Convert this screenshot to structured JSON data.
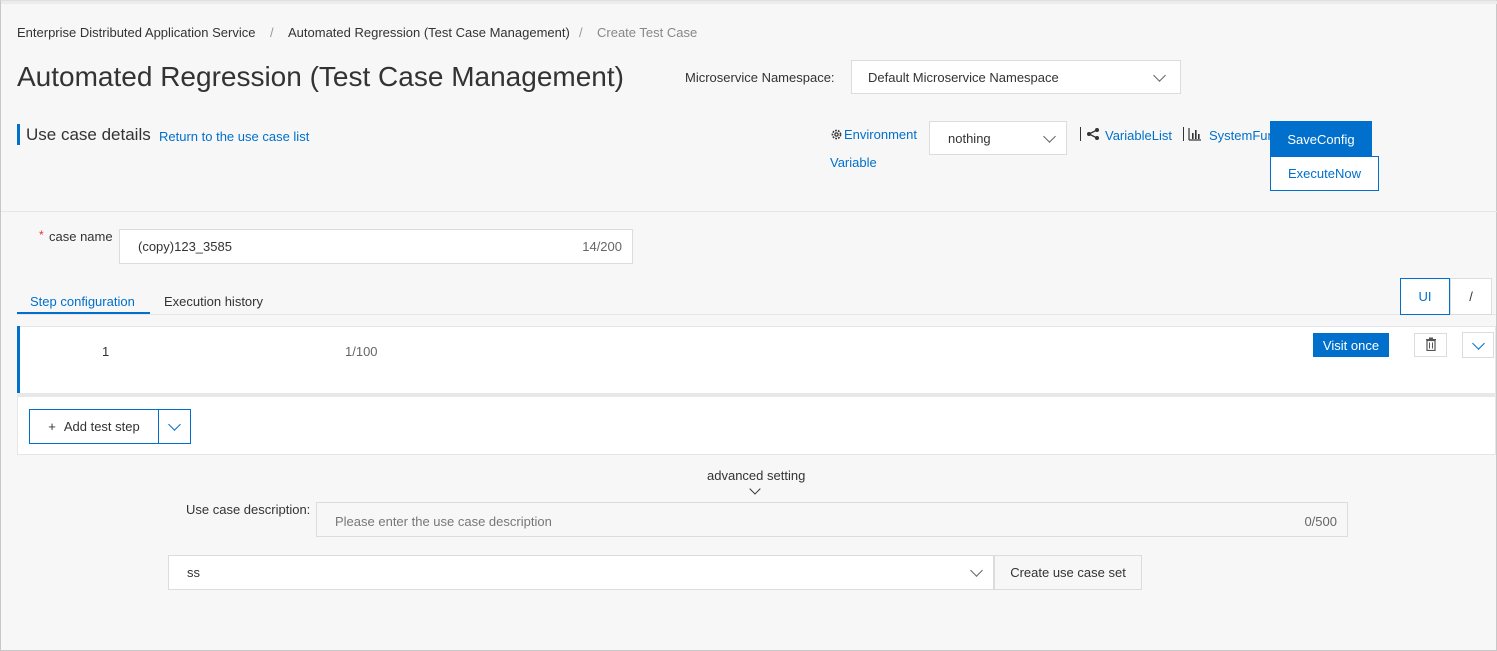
{
  "breadcrumb": [
    "Enterprise Distributed Application Service",
    "Automated Regression (Test Case Management)",
    "Create Test Case"
  ],
  "breadcrumb_separator": "/",
  "page_title": "Automated Regression (Test Case Management)",
  "namespace": {
    "label": "Microservice Namespace:",
    "value": "Default Microservice Namespace"
  },
  "section": {
    "title": "Use case details",
    "return_link": "Return to the use case list"
  },
  "toolbar": {
    "env_label_line1": "Environment",
    "env_label_line2": "Variable",
    "env_value": "nothing",
    "variable_list": "VariableList",
    "system_fun": "SystemFun",
    "save_config": "SaveConfig",
    "execute_now": "ExecuteNow"
  },
  "case_name": {
    "required_mark": "*",
    "label": "case name",
    "value": "(copy)123_3585",
    "counter": "14/200"
  },
  "tabs": [
    "Step configuration",
    "Execution history"
  ],
  "view_toggle": [
    "UI",
    "/"
  ],
  "step": {
    "index": "1",
    "counter": "1/100",
    "visit_once": "Visit once"
  },
  "add_step": {
    "plus": "+",
    "label": "Add test step"
  },
  "advanced": {
    "label": "advanced setting"
  },
  "description": {
    "label": "Use case description:",
    "placeholder": "Please enter the use case description",
    "counter": "0/500"
  },
  "case_set": {
    "value": "ss",
    "create_button": "Create use case set"
  },
  "colors": {
    "accent": "#0070cc",
    "background": "#f7f7f7"
  },
  "icons": [
    "gear-icon",
    "share-icon",
    "bar-chart-icon",
    "trash-icon",
    "chevron-down-icon"
  ]
}
